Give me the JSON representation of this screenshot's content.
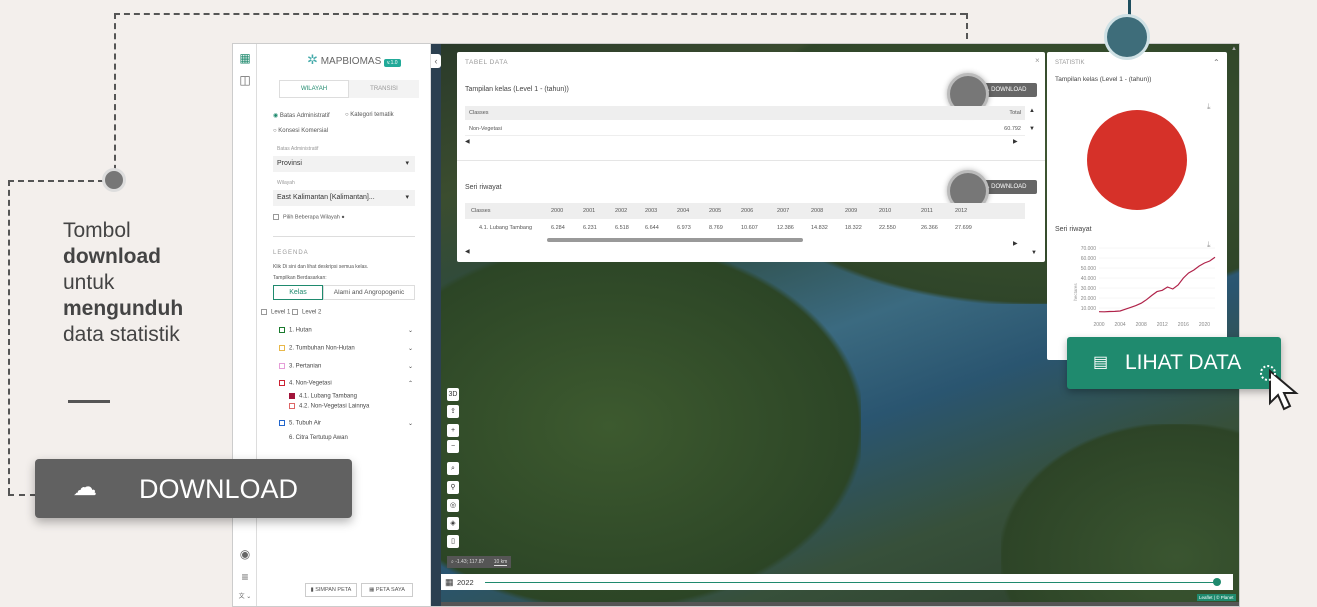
{
  "annotation": {
    "line1": "Tombol",
    "line2": "download",
    "line3": "untuk",
    "line4": "mengunduh",
    "line5": "data statistik"
  },
  "download_big": {
    "label": "DOWNLOAD"
  },
  "lihat_data": {
    "label": "LIHAT DATA"
  },
  "sidebar": {
    "logo": "MAPBIOMAS",
    "version": "v.1.0",
    "tabs": [
      "WILAYAH",
      "TRANSISI"
    ],
    "radio1": "Batas Administratif",
    "radio2": "Kategori tematik",
    "radio3": "Konsesi Komersial",
    "admin_label": "Batas Administratif",
    "admin_value": "Provinsi",
    "wilayah_label": "Wilayah",
    "wilayah_value": "East Kalimantan [Kalimantan]...",
    "multi": "Pilih Beberapa Wilayah",
    "legenda": "LEGENDA",
    "legenda_note": "Klik Di sini dan lihat deskripsi semua kelas.",
    "tampilkan": "Tampilkan Berdasarkan:",
    "kelas": "Kelas",
    "alami": "Alami and Angropogenic",
    "level1": "Level 1",
    "level2": "Level 2",
    "items": [
      "1. Hutan",
      "2. Tumbuhan Non-Hutan",
      "3. Pertanian",
      "4. Non-Vegetasi",
      "4.1. Lubang Tambang",
      "4.2. Non-Vegetasi Lainnya",
      "5. Tubuh Air",
      "6. Citra Tertutup Awan"
    ],
    "simpan": "SIMPAN PETA",
    "petasaya": "PETA SAYA"
  },
  "tabel": {
    "title": "TABEL DATA",
    "sub1": "Tampilan kelas (Level 1 - (tahun))",
    "classes": "Classes",
    "total": "Total",
    "row1": "Non-Vegetasi",
    "row1_total": "60.792",
    "download": "DOWNLOAD",
    "sub2": "Seri riwayat",
    "years": [
      "2000",
      "2001",
      "2002",
      "2003",
      "2004",
      "2005",
      "2006",
      "2007",
      "2008",
      "2009",
      "2010",
      "2011",
      "2012"
    ],
    "row2": "4.1. Lubang Tambang",
    "row2_vals": [
      "6.284",
      "6.231",
      "6.518",
      "6.644",
      "6.973",
      "8.769",
      "10.607",
      "12.386",
      "14.832",
      "18.322",
      "22.550",
      "26.366",
      "27.699"
    ]
  },
  "statistik": {
    "title": "STATISTIK",
    "sub1": "Tampilan kelas (Level 1 - (tahun))",
    "sub2": "Seri riwayat",
    "yticks": [
      "70.000",
      "60.000",
      "50.000",
      "40.000",
      "30.000",
      "20.000",
      "10.000"
    ],
    "xticks": [
      "2000",
      "2004",
      "2008",
      "2012",
      "2016",
      "2020"
    ],
    "ylabel": "hectares"
  },
  "timeline": {
    "year": "2022"
  },
  "coords": "-1.43; 117.87",
  "scale": "10 km",
  "attribution": "Leaflet | © Planet",
  "colors": {
    "accent": "#1f8a6e",
    "pie": "#d63129",
    "series": "#b0234a"
  },
  "chart_data": {
    "type": "line",
    "x": [
      2000,
      2001,
      2002,
      2003,
      2004,
      2005,
      2006,
      2007,
      2008,
      2009,
      2010,
      2011,
      2012,
      2013,
      2014,
      2015,
      2016,
      2017,
      2018,
      2019,
      2020,
      2021,
      2022
    ],
    "series": [
      {
        "values": [
          6284,
          6231,
          6518,
          6644,
          6973,
          8769,
          10607,
          12386,
          14832,
          18322,
          22550,
          26366,
          27699,
          31000,
          29000,
          33000,
          40000,
          45000,
          48000,
          52000,
          55000,
          57000,
          60792
        ]
      }
    ],
    "ylabel": "hectares",
    "ylim": [
      0,
      70000
    ]
  }
}
